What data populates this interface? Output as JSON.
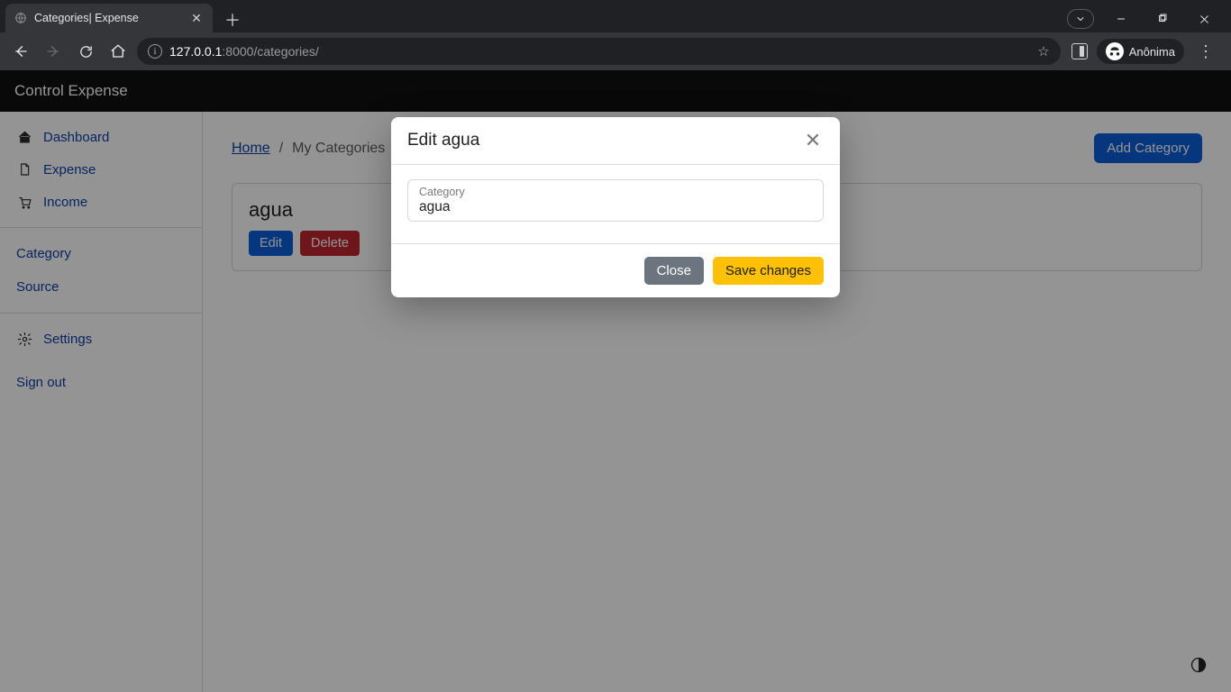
{
  "browser": {
    "tab_title": "Categories| Expense",
    "url_host": "127.0.0.1",
    "url_port": ":8000",
    "url_path": "/categories/",
    "incognito_label": "Anônima"
  },
  "app": {
    "brand": "Control Expense"
  },
  "sidebar": {
    "nav": [
      {
        "label": "Dashboard",
        "icon": "home-icon"
      },
      {
        "label": "Expense",
        "icon": "file-icon"
      },
      {
        "label": "Income",
        "icon": "cart-icon"
      }
    ],
    "secondary": [
      {
        "label": "Category"
      },
      {
        "label": "Source"
      }
    ],
    "settings_label": "Settings",
    "signout_label": "Sign out"
  },
  "page": {
    "breadcrumb_home": "Home",
    "breadcrumb_sep": "/",
    "breadcrumb_current": "My Categories",
    "add_button": "Add Category"
  },
  "category_card": {
    "name": "agua",
    "edit_label": "Edit",
    "delete_label": "Delete"
  },
  "modal": {
    "title": "Edit agua",
    "field_label": "Category",
    "field_value": "agua",
    "close_label": "Close",
    "save_label": "Save changes"
  },
  "colors": {
    "primary": "#0b5ed7",
    "danger": "#c02632",
    "secondary": "#6c757d",
    "warning": "#ffc107",
    "link": "#0d3ea8",
    "chrome_bg": "#202124",
    "chrome_surface": "#35363a"
  }
}
